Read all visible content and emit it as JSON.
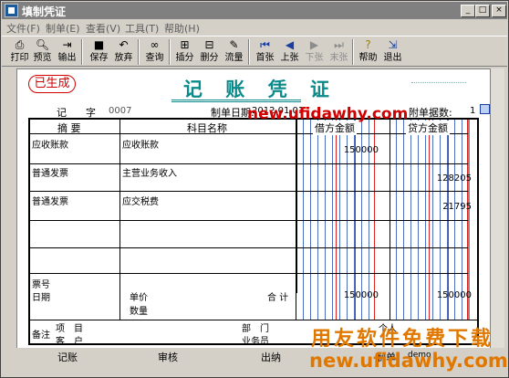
{
  "window": {
    "title": "填制凭证",
    "minimize": "_",
    "maximize": "□",
    "close": "×"
  },
  "menu": [
    "文件(F)",
    "制单(E)",
    "查看(V)",
    "工具(T)",
    "帮助(H)"
  ],
  "toolbar": [
    {
      "label": "打印",
      "icon": "printer-icon"
    },
    {
      "label": "预览",
      "icon": "preview-icon"
    },
    {
      "label": "输出",
      "icon": "export-icon"
    },
    {
      "label": "保存",
      "icon": "save-icon"
    },
    {
      "label": "放弃",
      "icon": "undo-icon"
    },
    {
      "label": "查询",
      "icon": "binoculars-icon"
    },
    {
      "label": "插分",
      "icon": "insert-row-icon"
    },
    {
      "label": "删分",
      "icon": "delete-row-icon"
    },
    {
      "label": "流量",
      "icon": "cashflow-icon"
    },
    {
      "label": "首张",
      "icon": "first-icon"
    },
    {
      "label": "上张",
      "icon": "prev-icon"
    },
    {
      "label": "下张",
      "icon": "next-icon"
    },
    {
      "label": "末张",
      "icon": "last-icon"
    },
    {
      "label": "帮助",
      "icon": "help-icon"
    },
    {
      "label": "退出",
      "icon": "exit-icon"
    }
  ],
  "voucher": {
    "stamp": "已生成",
    "title": "记 账 凭 证",
    "type_label": "记",
    "zi_label": "字",
    "number": "0007",
    "date_label": "制单日期:",
    "date": "2012.01.01",
    "attach_label": "附单据数:",
    "attach_count": "1"
  },
  "columns": {
    "summary": "摘 要",
    "account": "科目名称",
    "debit": "借方金额",
    "credit": "贷方金额"
  },
  "rows": [
    {
      "summary": "应收账款",
      "account": "应收账款",
      "debit": "150000",
      "credit": ""
    },
    {
      "summary": "普通发票",
      "account": "主营业务收入",
      "debit": "",
      "credit": "128205"
    },
    {
      "summary": "普通发票",
      "account": "应交税费",
      "debit": "",
      "credit": "21795"
    },
    {
      "summary": "",
      "account": "",
      "debit": "",
      "credit": ""
    },
    {
      "summary": "",
      "account": "",
      "debit": "",
      "credit": ""
    }
  ],
  "footer": {
    "ticket_label": "票号",
    "date_label": "日期",
    "price_label": "单价",
    "qty_label": "数量",
    "total_label": "合 计",
    "total_debit": "150000",
    "total_credit": "150000",
    "note_label": "备注",
    "project_label": "项　目",
    "customer_label": "客　户",
    "dept_label": "部　门",
    "staff_label": "业务员",
    "person_label": "个人"
  },
  "status": {
    "book_label": "记账",
    "audit_label": "审核",
    "cashier_label": "出纳",
    "maker_label": "制单",
    "maker": "demo"
  },
  "watermarks": [
    "new.ufidawhy.com",
    "用友软件免费下载",
    "new.ufidawhy.com"
  ],
  "colors": {
    "title": "#0a8a8a",
    "stamp": "#d00000",
    "grid_blue": "#4c6fc4",
    "grid_red": "#d22",
    "watermark_red": "#d00000",
    "watermark_orange": "#e07800"
  }
}
